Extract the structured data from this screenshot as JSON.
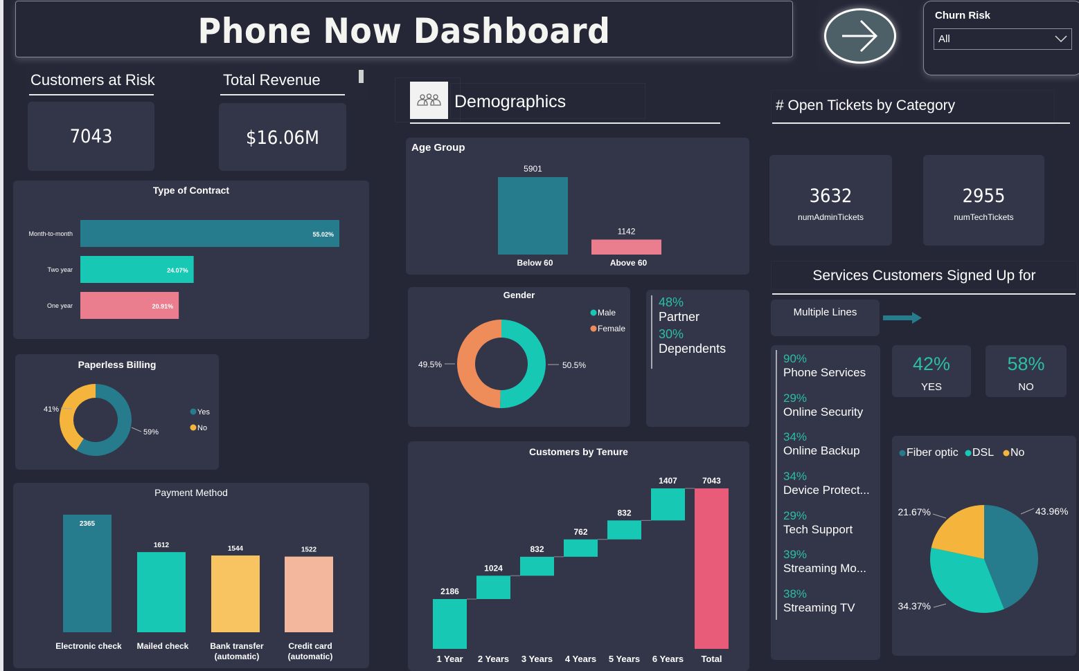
{
  "header": {
    "title": "Phone Now Dashboard"
  },
  "nav": {
    "icon": "arrow-right-icon"
  },
  "slicer": {
    "label": "Churn Risk",
    "selected": "All"
  },
  "kpis": {
    "customers_at_risk": {
      "label": "Customers at Risk",
      "value": "7043"
    },
    "total_revenue": {
      "label": "Total Revenue",
      "value": "$16.06M"
    }
  },
  "demographics": {
    "heading": "Demographics",
    "icon": "people-group-icon"
  },
  "open_tickets": {
    "heading": "# Open Tickets by Category",
    "admin": {
      "value": "3632",
      "label": "numAdminTickets"
    },
    "tech": {
      "value": "2955",
      "label": "numTechTickets"
    }
  },
  "services": {
    "heading": "Services Customers Signed Up for",
    "multiple_lines_label": "Multiple Lines",
    "multiple_lines_yes": {
      "value": "42%",
      "label": "YES"
    },
    "multiple_lines_no": {
      "value": "58%",
      "label": "NO"
    },
    "list": [
      {
        "pct": "90%",
        "name": "Phone Services"
      },
      {
        "pct": "29%",
        "name": "Online Security"
      },
      {
        "pct": "34%",
        "name": "Online Backup"
      },
      {
        "pct": "34%",
        "name": "Device Protect..."
      },
      {
        "pct": "29%",
        "name": "Tech Support"
      },
      {
        "pct": "39%",
        "name": "Streaming Mo..."
      },
      {
        "pct": "38%",
        "name": "Streaming TV"
      }
    ]
  },
  "partner_dependents": [
    {
      "pct": "48%",
      "name": "Partner"
    },
    {
      "pct": "30%",
      "name": "Dependents"
    }
  ],
  "colors": {
    "teal_dark": "#267b8c",
    "teal": "#17c9b5",
    "pink": "#ea7e8f",
    "yellow": "#f5b43c",
    "orange": "#ee8c5a",
    "peach": "#f2b79c",
    "amber": "#f8c462",
    "red_total": "#e85c79"
  },
  "chart_data": [
    {
      "id": "contract",
      "type": "bar",
      "orientation": "horizontal",
      "title": "Type of Contract",
      "categories": [
        "Month-to-month",
        "Two year",
        "One year"
      ],
      "values": [
        55.02,
        24.07,
        20.91
      ],
      "labels": [
        "55.02%",
        "24.07%",
        "20.91%"
      ],
      "colors": [
        "#267b8c",
        "#17c9b5",
        "#ea7e8f"
      ],
      "xlim": [
        0,
        65
      ]
    },
    {
      "id": "paperless",
      "type": "pie",
      "donut": true,
      "title": "Paperless Billing",
      "categories": [
        "Yes",
        "No"
      ],
      "values": [
        59,
        41
      ],
      "labels": [
        "59%",
        "41%"
      ],
      "colors": [
        "#267b8c",
        "#f5b43c"
      ],
      "legend": "right"
    },
    {
      "id": "payment",
      "type": "bar",
      "title": "Payment Method",
      "categories": [
        "Electronic check",
        "Mailed check",
        "Bank transfer (automatic)",
        "Credit card (automatic)"
      ],
      "category_lines": [
        [
          "Electronic check"
        ],
        [
          "Mailed check"
        ],
        [
          "Bank transfer",
          "(automatic)"
        ],
        [
          "Credit card",
          "(automatic)"
        ]
      ],
      "values": [
        2365,
        1612,
        1544,
        1522
      ],
      "colors": [
        "#267b8c",
        "#17c9b5",
        "#f8c462",
        "#f2b79c"
      ],
      "ylim": [
        0,
        2365
      ]
    },
    {
      "id": "age",
      "type": "bar",
      "title": "Age Group",
      "categories": [
        "Below 60",
        "Above 60"
      ],
      "values": [
        5901,
        1142
      ],
      "colors": [
        "#267b8c",
        "#ea7e8f"
      ],
      "ylim": [
        0,
        5901
      ]
    },
    {
      "id": "gender",
      "type": "pie",
      "donut": true,
      "title": "Gender",
      "categories": [
        "Male",
        "Female"
      ],
      "values": [
        50.5,
        49.5
      ],
      "labels": [
        "50.5%",
        "49.5%"
      ],
      "colors": [
        "#17c9b5",
        "#ee8c5a"
      ],
      "legend": "top-right"
    },
    {
      "id": "tenure",
      "type": "bar",
      "subtype": "waterfall",
      "title": "Customers by Tenure",
      "categories": [
        "1 Year",
        "2 Years",
        "3 Years",
        "4 Years",
        "5 Years",
        "6 Years",
        "Total"
      ],
      "values": [
        2186,
        1024,
        832,
        762,
        832,
        1407,
        7043
      ],
      "colors": {
        "increase": "#17c9b5",
        "total": "#e85c79"
      },
      "ylim": [
        0,
        7043
      ]
    },
    {
      "id": "internet",
      "type": "pie",
      "title": "",
      "categories": [
        "Fiber optic",
        "DSL",
        "No"
      ],
      "values": [
        43.96,
        34.37,
        21.67
      ],
      "labels": [
        "43.96%",
        "34.37%",
        "21.67%"
      ],
      "colors": [
        "#267b8c",
        "#17c9b5",
        "#f5b43c"
      ],
      "legend": "top-left"
    }
  ]
}
